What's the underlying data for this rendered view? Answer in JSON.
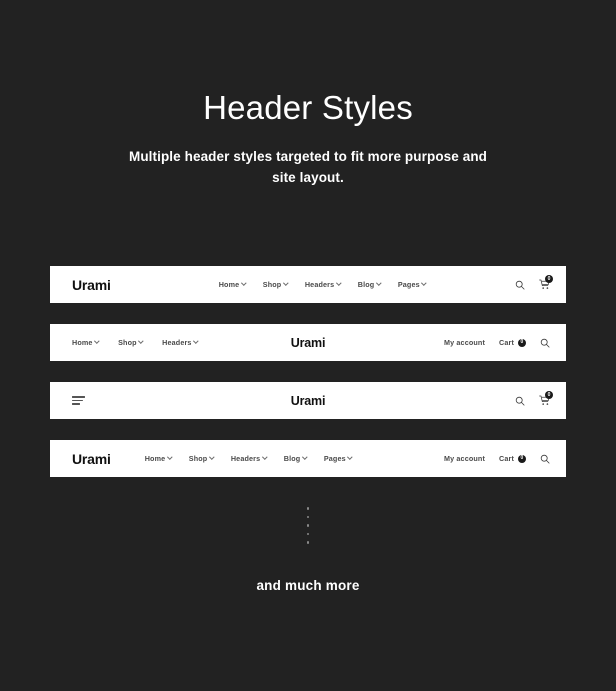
{
  "hero": {
    "title": "Header Styles",
    "subtitle": "Multiple header styles targeted to fit more purpose and site layout."
  },
  "colors": {
    "background": "#222222",
    "card": "#ffffff",
    "text_light": "#ffffff",
    "nav_text": "#4a4a4a",
    "logo_text": "#111111",
    "badge_bg": "#1a1a1a"
  },
  "brand": "Urami",
  "icons": {
    "search": "search-icon",
    "cart": "cart-icon",
    "menu": "hamburger-icon",
    "chevron": "chevron-down-icon"
  },
  "headers": [
    {
      "id": "header-style-1",
      "logo": "Urami",
      "nav": [
        {
          "label": "Home",
          "has_caret": true
        },
        {
          "label": "Shop",
          "has_caret": true
        },
        {
          "label": "Headers",
          "has_caret": true
        },
        {
          "label": "Blog",
          "has_caret": true
        },
        {
          "label": "Pages",
          "has_caret": true
        }
      ],
      "search_label": "Search",
      "cart_count": "0"
    },
    {
      "id": "header-style-2",
      "logo": "Urami",
      "nav": [
        {
          "label": "Home",
          "has_caret": true
        },
        {
          "label": "Shop",
          "has_caret": true
        },
        {
          "label": "Headers",
          "has_caret": true
        }
      ],
      "account_label": "My account",
      "cart_label": "Cart",
      "cart_count": "0",
      "search_label": "Search"
    },
    {
      "id": "header-style-3",
      "logo": "Urami",
      "menu_label": "Menu",
      "search_label": "Search",
      "cart_count": "0"
    },
    {
      "id": "header-style-4",
      "logo": "Urami",
      "nav": [
        {
          "label": "Home",
          "has_caret": true
        },
        {
          "label": "Shop",
          "has_caret": true
        },
        {
          "label": "Headers",
          "has_caret": true
        },
        {
          "label": "Blog",
          "has_caret": true
        },
        {
          "label": "Pages",
          "has_caret": true
        }
      ],
      "account_label": "My account",
      "cart_label": "Cart",
      "cart_count": "0",
      "search_label": "Search"
    }
  ],
  "footer": {
    "dots_count": 5,
    "caption": "and much more"
  }
}
